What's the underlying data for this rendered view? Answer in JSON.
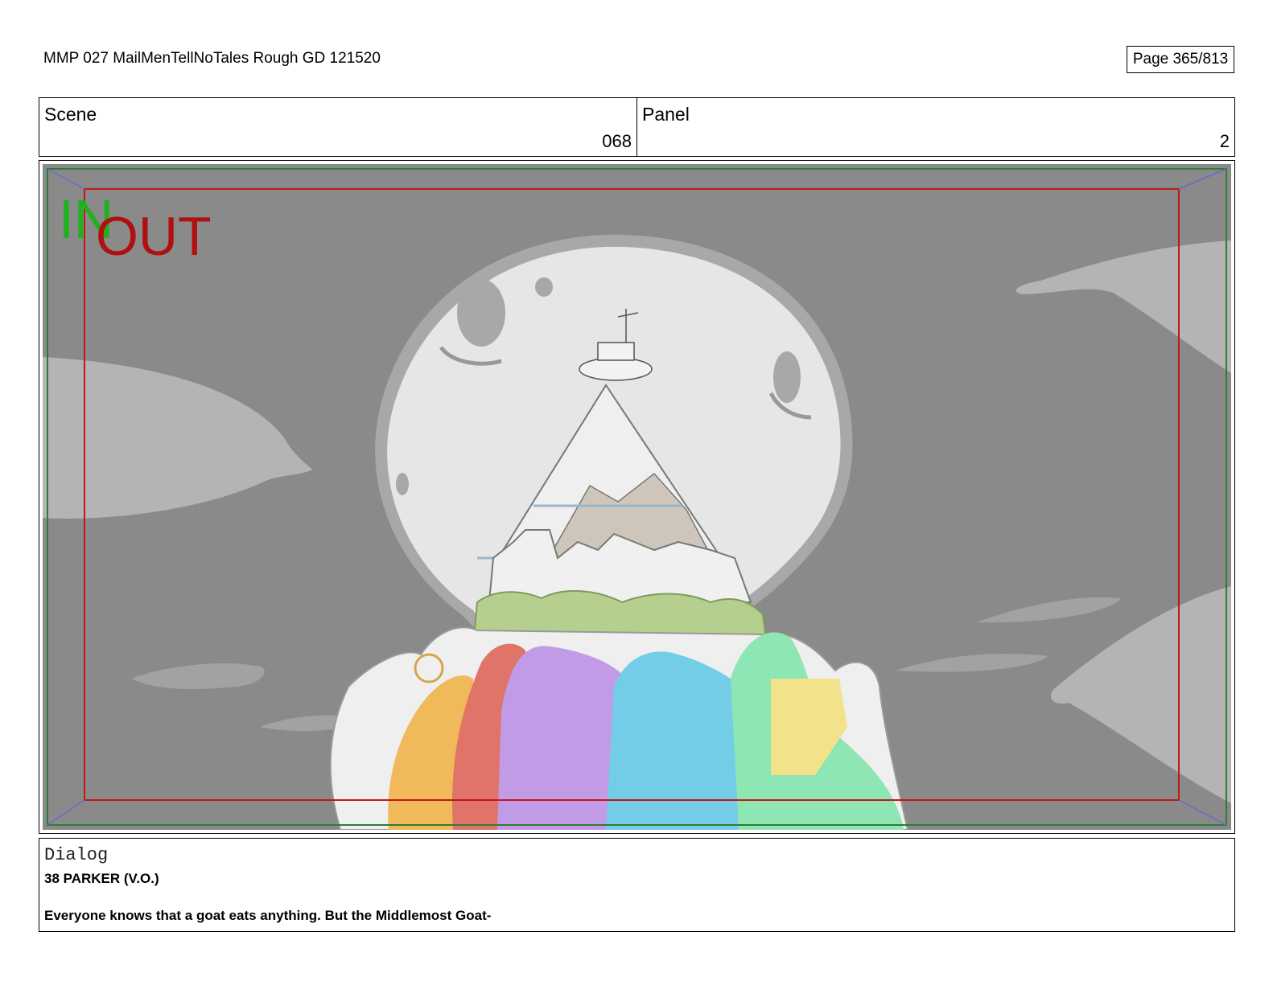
{
  "header": {
    "doc_title": "MMP 027 MailMenTellNoTales Rough GD 121520",
    "page_label": "Page 365/813"
  },
  "info": {
    "scene_label": "Scene",
    "scene_value": "068",
    "panel_label": "Panel",
    "panel_value": "2"
  },
  "frame": {
    "in_label": "IN",
    "out_label": "OUT",
    "colors": {
      "background": "#8a8a8a",
      "in_marker": "#1db31d",
      "out_marker": "#b01010",
      "in_frame": "#2e7d32",
      "out_frame": "#c01818",
      "moon": "#e6e6e6"
    }
  },
  "dialog": {
    "label": "Dialog",
    "speaker": "38 PARKER (V.O.)",
    "line": "Everyone knows that a goat eats anything. But the Middlemost Goat-"
  }
}
